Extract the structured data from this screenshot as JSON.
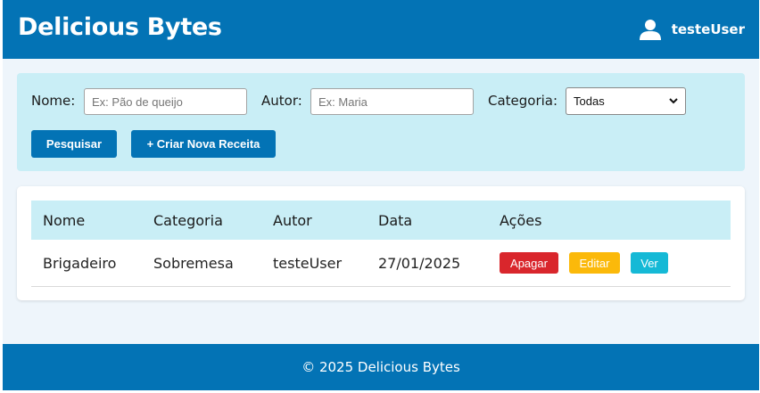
{
  "header": {
    "brand": "Delicious Bytes",
    "username": "testeUser",
    "user_icon": "user-icon"
  },
  "filters": {
    "name_label": "Nome:",
    "name_placeholder": "Ex: Pão de queijo",
    "author_label": "Autor:",
    "author_placeholder": "Ex: Maria",
    "category_label": "Categoria:",
    "category_selected": "Todas",
    "search_button": "Pesquisar",
    "create_button": "+ Criar Nova Receita"
  },
  "table": {
    "columns": [
      "Nome",
      "Categoria",
      "Autor",
      "Data",
      "Ações"
    ],
    "rows": [
      {
        "name": "Brigadeiro",
        "category": "Sobremesa",
        "author": "testeUser",
        "date": "27/01/2025",
        "actions": {
          "delete": "Apagar",
          "edit": "Editar",
          "view": "Ver"
        }
      }
    ]
  },
  "footer": {
    "text": "© 2025 Delicious Bytes"
  },
  "colors": {
    "primary": "#0373b5",
    "filter_bg": "#c9eef6",
    "danger": "#d9262c",
    "warning": "#fbb90a",
    "info": "#15b9d6"
  }
}
